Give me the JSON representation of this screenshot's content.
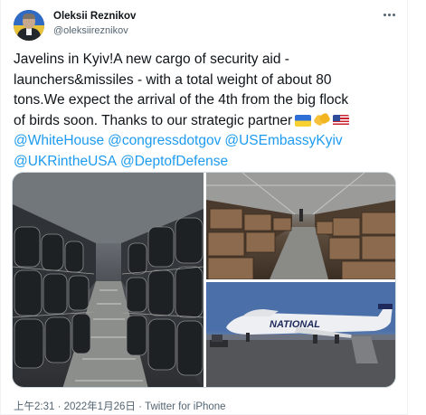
{
  "tweet": {
    "author_name": "Oleksii Reznikov",
    "author_handle": "@oleksiireznikov",
    "text_lines": [
      "Javelins in Kyiv!A new cargo of security aid -",
      "launchers&missiles - with a total weight of about 80",
      "tons.We expect the arrival of the 4th from the big flock",
      "of birds soon. Thanks to our strategic partner"
    ],
    "emojis": [
      "ukraine-flag-icon",
      "handshake-icon",
      "us-flag-icon"
    ],
    "mentions": {
      "whitehouse": "@WhiteHouse",
      "congress": "@congressdotgov",
      "embassy": "@USEmbassyKyiv",
      "uk_usa": "@UKRintheUSA",
      "dod": "@DeptofDefense"
    },
    "timestamp": "上午2:31 · 2022年1月26日 · Twitter for iPhone"
  },
  "media": {
    "images": [
      {
        "name": "cargo-hold-javelin-crates-photo"
      },
      {
        "name": "cargo-pallets-photo"
      },
      {
        "name": "cargo-plane-national-photo",
        "aircraft_label": "NATIONAL"
      }
    ]
  },
  "colors": {
    "text": "#0f1419",
    "secondary": "#536471",
    "link": "#1d9bf0",
    "border": "#cfd9de"
  }
}
